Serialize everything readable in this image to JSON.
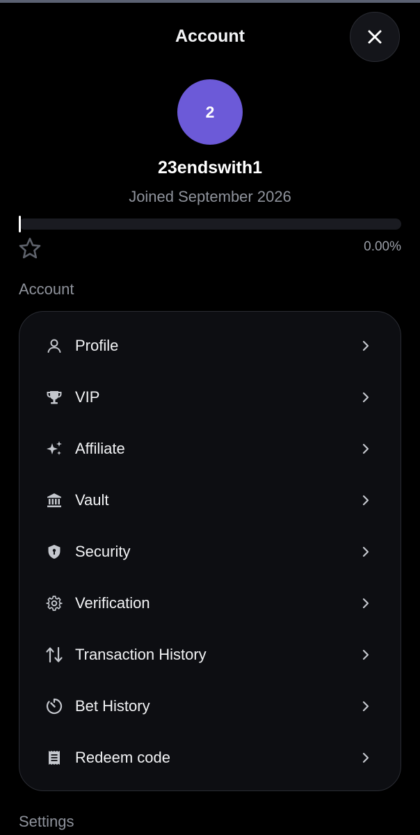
{
  "header": {
    "title": "Account"
  },
  "profile": {
    "avatar_initial": "2",
    "avatar_color": "#6c5ad8",
    "username": "23endswith1",
    "joined": "Joined September 2026"
  },
  "progress": {
    "percent_label": "0.00%",
    "percent_value": 0
  },
  "sections": {
    "account_label": "Account",
    "settings_label": "Settings"
  },
  "menu": {
    "items": [
      {
        "label": "Profile",
        "icon": "user-icon"
      },
      {
        "label": "VIP",
        "icon": "trophy-icon"
      },
      {
        "label": "Affiliate",
        "icon": "sparkles-icon"
      },
      {
        "label": "Vault",
        "icon": "bank-icon"
      },
      {
        "label": "Security",
        "icon": "shield-icon"
      },
      {
        "label": "Verification",
        "icon": "gear-icon"
      },
      {
        "label": "Transaction History",
        "icon": "arrows-up-down-icon"
      },
      {
        "label": "Bet History",
        "icon": "timer-icon"
      },
      {
        "label": "Redeem code",
        "icon": "receipt-icon"
      }
    ]
  }
}
